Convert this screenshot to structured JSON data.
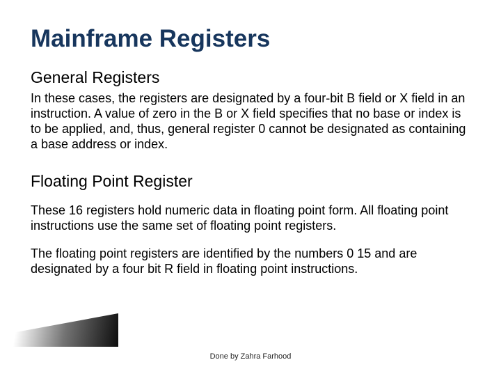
{
  "title": "Mainframe Registers",
  "sections": {
    "general": {
      "heading": "General Registers",
      "body": "In these cases, the registers are designated by a four-bit B field or X field in an instruction. A value of zero in the B or X field specifies that no base or index is to be applied, and, thus, general register 0 cannot be designated as containing a base address or index."
    },
    "floating": {
      "heading": "Floating Point Register",
      "body1": "These 16 registers hold numeric data in floating point form. All floating point instructions use the same set of floating point registers.",
      "body2": "The floating point registers are identified by the numbers 0 15 and are designated by a four bit R field in floating point instructions."
    }
  },
  "footer": "Done by Zahra Farhood"
}
